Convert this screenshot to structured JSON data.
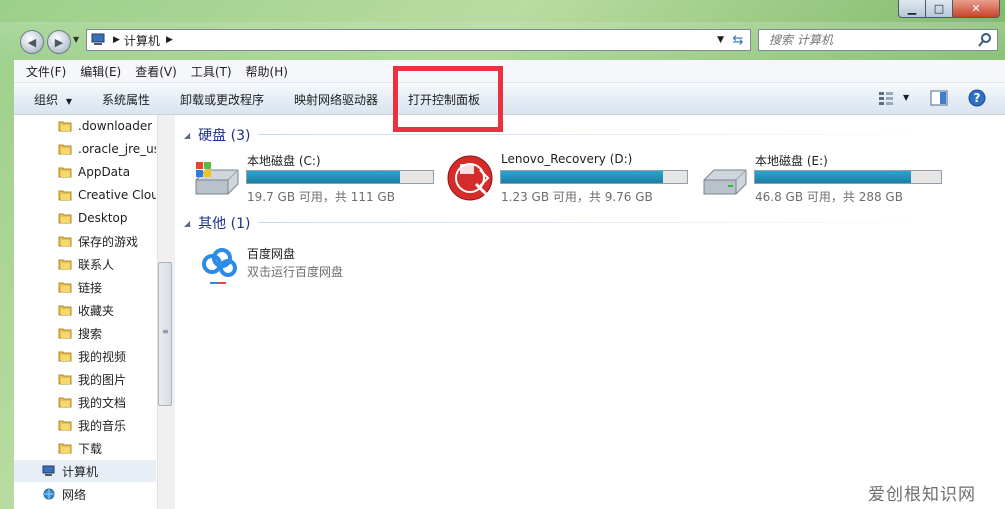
{
  "window": {
    "address": {
      "crumb": "计算机"
    },
    "search": {
      "placeholder": "搜索 计算机"
    }
  },
  "menu": [
    "文件(F)",
    "编辑(E)",
    "查看(V)",
    "工具(T)",
    "帮助(H)"
  ],
  "toolbar": {
    "organize": "组织",
    "system_properties": "系统属性",
    "uninstall": "卸载或更改程序",
    "map_drive": "映射网络驱动器",
    "control_panel": "打开控制面板"
  },
  "nav": [
    ".downloader",
    ".oracle_jre_usa",
    "AppData",
    "Creative Cloud",
    "Desktop",
    "保存的游戏",
    "联系人",
    "链接",
    "收藏夹",
    "搜索",
    "我的视频",
    "我的图片",
    "我的文档",
    "我的音乐",
    "下载",
    "计算机",
    "网络"
  ],
  "groups": {
    "disks": "硬盘 (3)",
    "other": "其他 (1)"
  },
  "drives": [
    {
      "name": "本地磁盘 (C:)",
      "space": "19.7 GB 可用，共 111 GB",
      "used_fraction": 0.82
    },
    {
      "name": "Lenovo_Recovery (D:)",
      "space": "1.23 GB 可用，共 9.76 GB",
      "used_fraction": 0.87
    },
    {
      "name": "本地磁盘 (E:)",
      "space": "46.8 GB 可用，共 288 GB",
      "used_fraction": 0.84
    }
  ],
  "other_item": {
    "name": "百度网盘",
    "desc": "双击运行百度网盘"
  },
  "watermark": "爱创根知识网",
  "colors": {
    "highlight": "#e8333f",
    "group_header": "#1e3287",
    "bar_fill": "#1a8fb9"
  }
}
